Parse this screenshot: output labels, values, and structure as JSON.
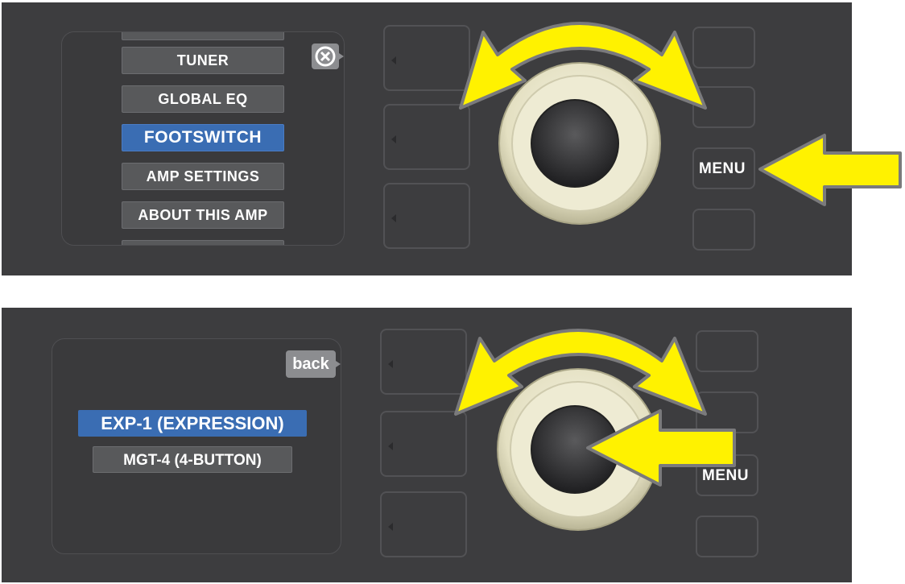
{
  "top_panel": {
    "menu_items": [
      {
        "label": "",
        "state": "partial"
      },
      {
        "label": "TUNER",
        "state": "normal"
      },
      {
        "label": "GLOBAL EQ",
        "state": "normal"
      },
      {
        "label": "FOOTSWITCH",
        "state": "selected"
      },
      {
        "label": "AMP SETTINGS",
        "state": "normal"
      },
      {
        "label": "ABOUT THIS AMP",
        "state": "normal"
      },
      {
        "label": "",
        "state": "partial"
      }
    ],
    "close_icon": "close-circle-icon",
    "menu_button_label": "MENU"
  },
  "bottom_panel": {
    "back_label": "back",
    "options": [
      {
        "label": "EXP-1 (EXPRESSION)",
        "state": "selected"
      },
      {
        "label": "MGT-4 (4-BUTTON)",
        "state": "normal"
      }
    ],
    "menu_button_label": "MENU"
  },
  "colors": {
    "panel": "#3d3d3f",
    "selected": "#3a6db3",
    "item": "#58595b",
    "arrow": "#fff200",
    "knob_ring": "#ece9cf"
  },
  "icons": {
    "rotate_arrow": "curved-double-arrow-icon",
    "press_arrow": "arrow-left-icon",
    "knob": "encoder-knob-icon"
  }
}
